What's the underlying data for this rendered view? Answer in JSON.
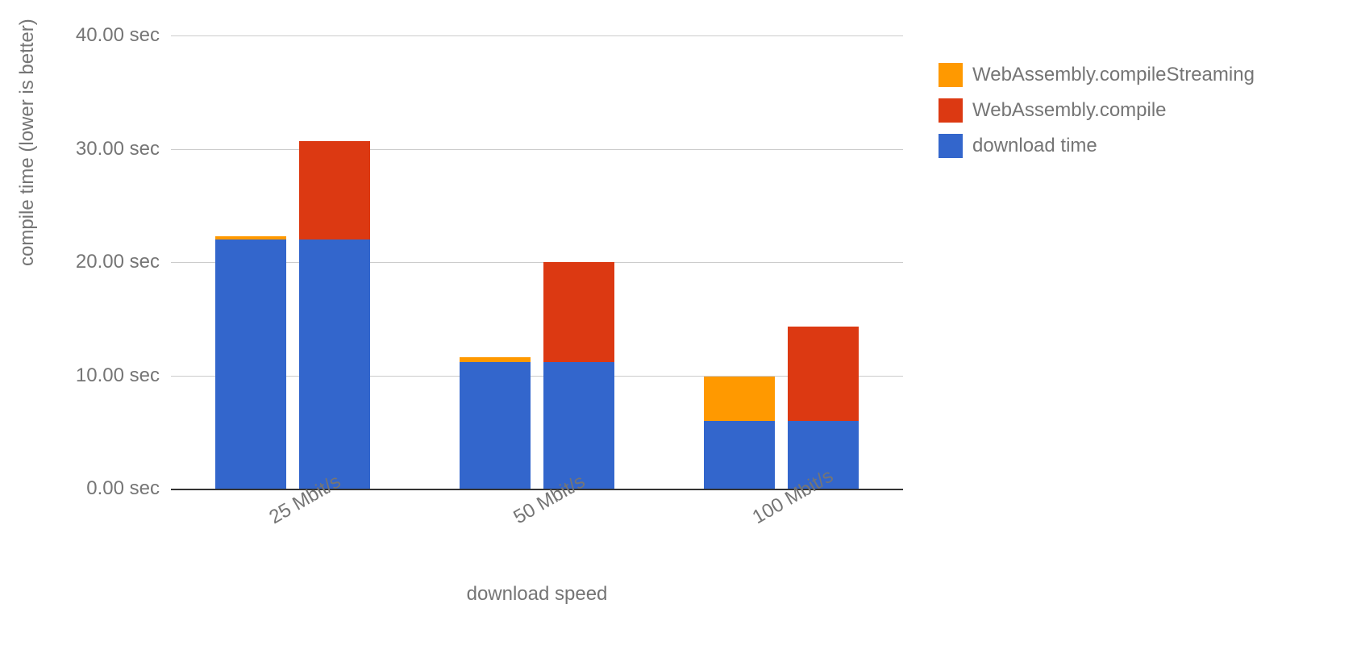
{
  "chart_data": {
    "type": "bar",
    "title": "",
    "xlabel": "download speed",
    "ylabel": "compile time (lower is better)",
    "ylim": [
      0,
      40
    ],
    "ytick_format": "0.00 sec",
    "yticks": [
      0,
      10,
      20,
      30,
      40
    ],
    "categories": [
      "25 Mbit/s",
      "50 Mbit/s",
      "100 Mbit/s"
    ],
    "legend": [
      {
        "name": "WebAssembly.compileStreaming",
        "color": "#ff9900"
      },
      {
        "name": "WebAssembly.compile",
        "color": "#dc3912"
      },
      {
        "name": "download time",
        "color": "#3366cc"
      }
    ],
    "series": [
      {
        "category": "25 Mbit/s",
        "bars": [
          {
            "stack": [
              {
                "series": "download time",
                "value": 22.0
              },
              {
                "series": "WebAssembly.compileStreaming",
                "value": 0.3
              }
            ]
          },
          {
            "stack": [
              {
                "series": "download time",
                "value": 22.0
              },
              {
                "series": "WebAssembly.compile",
                "value": 8.7
              }
            ]
          }
        ]
      },
      {
        "category": "50 Mbit/s",
        "bars": [
          {
            "stack": [
              {
                "series": "download time",
                "value": 11.2
              },
              {
                "series": "WebAssembly.compileStreaming",
                "value": 0.4
              }
            ]
          },
          {
            "stack": [
              {
                "series": "download time",
                "value": 11.2
              },
              {
                "series": "WebAssembly.compile",
                "value": 8.8
              }
            ]
          }
        ]
      },
      {
        "category": "100 Mbit/s",
        "bars": [
          {
            "stack": [
              {
                "series": "download time",
                "value": 6.0
              },
              {
                "series": "WebAssembly.compileStreaming",
                "value": 3.9
              }
            ]
          },
          {
            "stack": [
              {
                "series": "download time",
                "value": 6.0
              },
              {
                "series": "WebAssembly.compile",
                "value": 8.3
              }
            ]
          }
        ]
      }
    ]
  }
}
